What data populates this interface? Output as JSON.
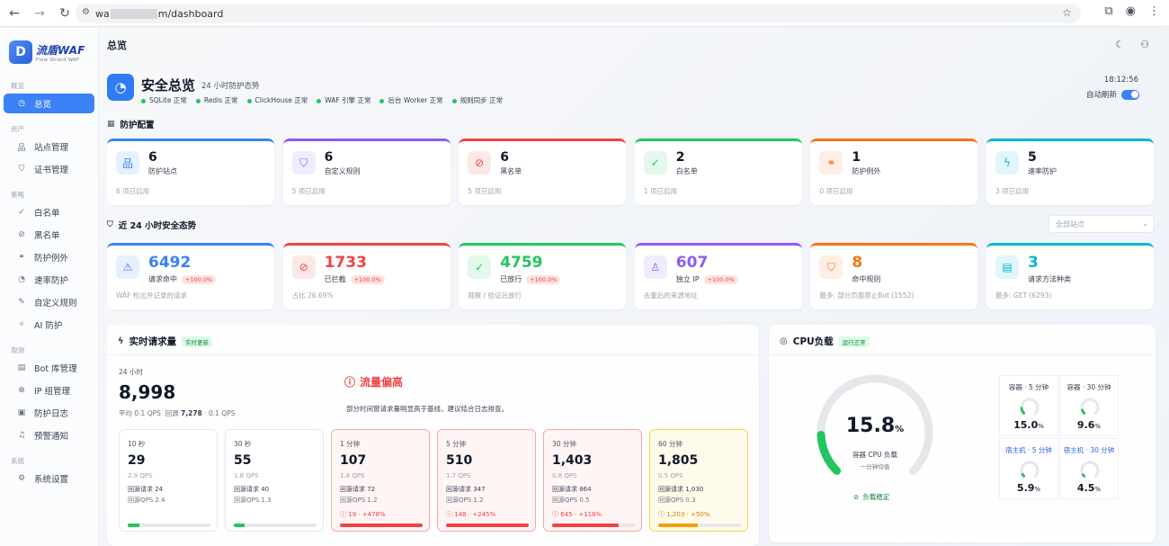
{
  "browser": {
    "url_prefix": "wa",
    "url_suffix": "m/dashboard"
  },
  "brand": {
    "name": "流盾WAF",
    "tagline": "Flow Shield WAF",
    "mark": "D"
  },
  "sidebar": {
    "sections": [
      {
        "label": "概览",
        "items": [
          {
            "label": "总览",
            "icon": "dashboard-icon",
            "active": true
          }
        ]
      },
      {
        "label": "资产",
        "items": [
          {
            "label": "站点管理",
            "icon": "sitemap-icon"
          },
          {
            "label": "证书管理",
            "icon": "shield-icon"
          }
        ]
      },
      {
        "label": "策略",
        "items": [
          {
            "label": "白名单",
            "icon": "check-circle-icon"
          },
          {
            "label": "黑名单",
            "icon": "ban-icon"
          },
          {
            "label": "防护例外",
            "icon": "link-icon"
          },
          {
            "label": "速率防护",
            "icon": "gauge-icon"
          },
          {
            "label": "自定义规则",
            "icon": "edit-icon"
          },
          {
            "label": "AI 防护",
            "icon": "ai-icon"
          }
        ]
      },
      {
        "label": "观测",
        "items": [
          {
            "label": "Bot 库管理",
            "icon": "bot-icon"
          },
          {
            "label": "IP 组管理",
            "icon": "globe-icon"
          },
          {
            "label": "防护日志",
            "icon": "log-icon"
          },
          {
            "label": "预警通知",
            "icon": "bell-icon"
          }
        ]
      },
      {
        "label": "系统",
        "items": [
          {
            "label": "系统设置",
            "icon": "gear-icon"
          }
        ]
      }
    ]
  },
  "header": {
    "title": "总览"
  },
  "overview": {
    "title": "安全总览",
    "subtitle": "24 小时防护态势",
    "time": "18:12:56",
    "auto_refresh_label": "自动刷新",
    "auto_refresh_on": true,
    "status": [
      "SQLite 正常",
      "Redis 正常",
      "ClickHouse 正常",
      "WAF 引擎 正常",
      "后台 Worker 正常",
      "规则同步 正常"
    ]
  },
  "config": {
    "heading": "防护配置",
    "cards": [
      {
        "value": "6",
        "label": "防护站点",
        "foot": "6 项已启用",
        "color": "#3b82f6",
        "icon": "sitemap-icon"
      },
      {
        "value": "6",
        "label": "自定义规则",
        "foot": "5 项已启用",
        "color": "#8b5cf6",
        "icon": "shield-icon"
      },
      {
        "value": "6",
        "label": "黑名单",
        "foot": "5 项已启用",
        "color": "#ef4444",
        "icon": "ban-icon"
      },
      {
        "value": "2",
        "label": "白名单",
        "foot": "1 项已启用",
        "color": "#22c55e",
        "icon": "check-circle-icon"
      },
      {
        "value": "1",
        "label": "防护例外",
        "foot": "0 项已启用",
        "color": "#f97316",
        "icon": "link-icon"
      },
      {
        "value": "5",
        "label": "速率防护",
        "foot": "3 项已启用",
        "color": "#06b6d4",
        "icon": "bolt-icon"
      }
    ]
  },
  "trend": {
    "heading": "近 24 小时安全态势",
    "site_select_placeholder": "全部站点",
    "cards": [
      {
        "value": "6492",
        "label": "请求命中",
        "badge": "+100.0%",
        "foot": "WAF 检出并记录的请求",
        "color": "#3b82f6",
        "icon": "alarm-icon"
      },
      {
        "value": "1733",
        "label": "已拦截",
        "badge": "+100.0%",
        "foot": "占比 26.69%",
        "color": "#ef4444",
        "icon": "ban-icon"
      },
      {
        "value": "4759",
        "label": "已放行",
        "badge": "+100.0%",
        "foot": "观察 / 验证后放行",
        "color": "#22c55e",
        "icon": "check-circle-icon"
      },
      {
        "value": "607",
        "label": "独立 IP",
        "badge": "+100.0%",
        "foot": "去重后的来源地址",
        "color": "#8b5cf6",
        "icon": "user-icon"
      },
      {
        "value": "8",
        "label": "命中规则",
        "badge": "",
        "foot": "最多: 部分页面禁止Bot (1552)",
        "color": "#f97316",
        "icon": "shield-icon"
      },
      {
        "value": "3",
        "label": "请求方法种类",
        "badge": "",
        "foot": "最多: GET (6293)",
        "color": "#06b6d4",
        "icon": "file-icon"
      }
    ]
  },
  "realtime": {
    "title": "实时请求量",
    "tag": "实时更新",
    "period_label": "24 小时",
    "total": "8,998",
    "avg_prefix": "平均 0.1 QPS",
    "origin_label": "回源",
    "origin_value": "7,278",
    "origin_qps": "· 0.1 QPS",
    "alert_title": "流量偏高",
    "alert_text": "部分时间窗请求量明显高于基线，建议结合日志排查。",
    "windows": [
      {
        "label": "10 秒",
        "value": "29",
        "qps": "2.9 QPS",
        "origin_req": "回源请求 24",
        "origin_qps": "回源QPS 2.4",
        "delta": "",
        "state": "normal",
        "level": 0.14
      },
      {
        "label": "30 秒",
        "value": "55",
        "qps": "1.8 QPS",
        "origin_req": "回源请求 40",
        "origin_qps": "回源QPS 1.3",
        "delta": "",
        "state": "normal",
        "level": 0.13
      },
      {
        "label": "1 分钟",
        "value": "107",
        "qps": "1.8 QPS",
        "origin_req": "回源请求 72",
        "origin_qps": "回源QPS 1.2",
        "delta": "19 · +478%",
        "state": "warn",
        "level": 1.0
      },
      {
        "label": "5 分钟",
        "value": "510",
        "qps": "1.7 QPS",
        "origin_req": "回源请求 347",
        "origin_qps": "回源QPS 1.2",
        "delta": "148 · +245%",
        "state": "warn",
        "level": 1.0
      },
      {
        "label": "30 分钟",
        "value": "1,403",
        "qps": "0.8 QPS",
        "origin_req": "回源请求 864",
        "origin_qps": "回源QPS 0.5",
        "delta": "645 · +118%",
        "state": "warn",
        "level": 0.8
      },
      {
        "label": "60 分钟",
        "value": "1,805",
        "qps": "0.5 QPS",
        "origin_req": "回源请求 1,030",
        "origin_qps": "回源QPS 0.3",
        "delta": "1,203 · +50%",
        "state": "amber",
        "level": 0.48
      }
    ]
  },
  "cpu": {
    "title": "CPU负载",
    "tag": "运行正常",
    "value": "15.8",
    "unit": "%",
    "label": "容器 CPU 负载",
    "sub": "一分钟均值",
    "status": "负载稳定",
    "level": 0.158,
    "small": [
      {
        "title": "容器 · 5 分钟",
        "value": "15.0",
        "level": 0.15,
        "blue": false
      },
      {
        "title": "容器 · 30 分钟",
        "value": "9.6",
        "level": 0.096,
        "blue": false
      },
      {
        "title": "宿主机 · 5 分钟",
        "value": "5.9",
        "level": 0.059,
        "blue": true
      },
      {
        "title": "宿主机 · 30 分钟",
        "value": "4.5",
        "level": 0.045,
        "blue": true
      }
    ]
  },
  "colors": {
    "accent": "#3b82f6",
    "ok": "#22c55e",
    "danger": "#ef4444",
    "warn": "#f59e0b"
  }
}
